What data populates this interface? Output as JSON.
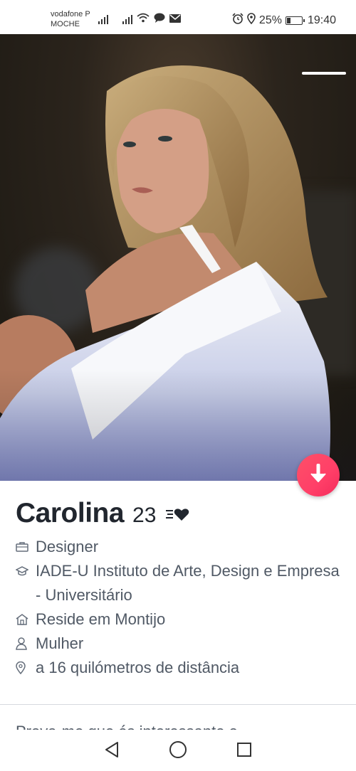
{
  "status_bar": {
    "carrier_line1": "vodafone P",
    "carrier_line2": "MOCHE",
    "battery_text": "25%",
    "battery_level": 0.25,
    "time": "19:40"
  },
  "profile": {
    "name": "Carolina",
    "age": "23",
    "job": "Designer",
    "school": "IADE-U Instituto de Arte, Design e Empresa - Universitário",
    "residence": "Reside em Montijo",
    "gender": "Mulher",
    "distance": "a 16 quilómetros de distância",
    "bio": "Prova-me que és interessante e"
  },
  "icons": {
    "signal": "signal-icon",
    "wifi": "wifi-icon",
    "message": "message-icon",
    "mail": "mail-icon",
    "alarm": "alarm-icon",
    "location": "location-icon",
    "briefcase": "briefcase-icon",
    "graduation": "graduation-cap-icon",
    "home": "home-icon",
    "person": "person-icon",
    "pin": "map-pin-icon",
    "heart_speed": "heart-speed-icon",
    "arrow_down": "arrow-down-icon",
    "nav_back": "back-triangle-icon",
    "nav_home": "home-circle-icon",
    "nav_recent": "recent-square-icon"
  },
  "colors": {
    "accent": "#fd5068",
    "text_primary": "#21262e",
    "text_secondary": "#505965"
  }
}
